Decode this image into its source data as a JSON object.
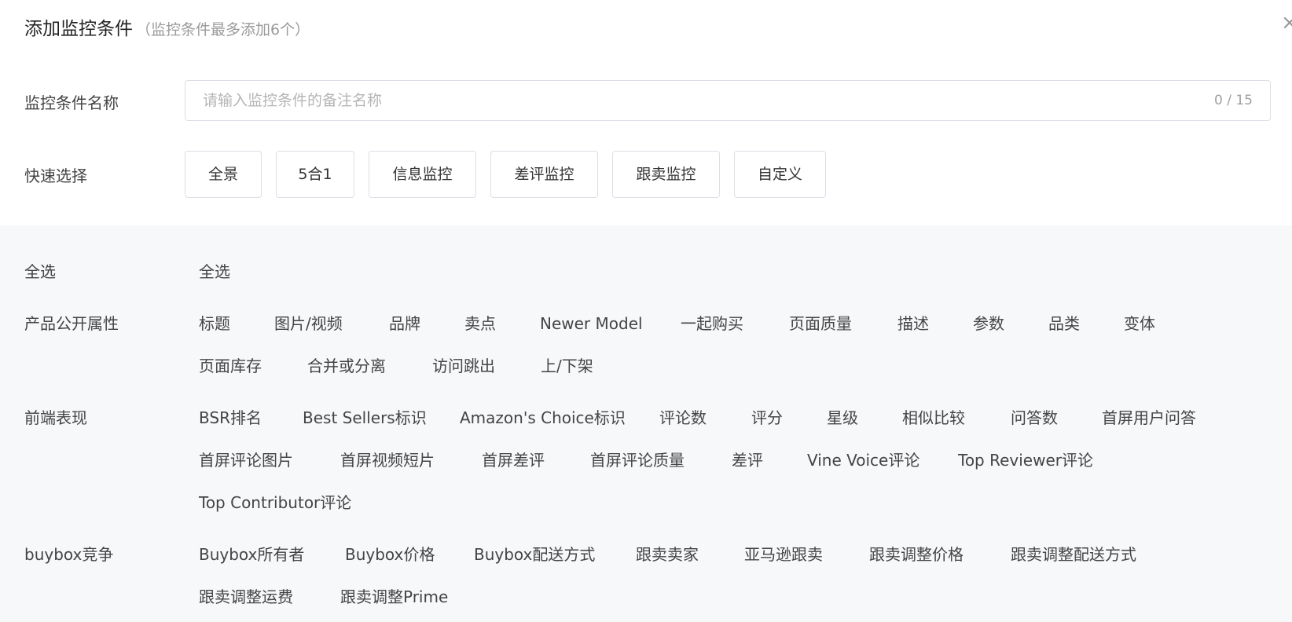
{
  "dialog": {
    "title": "添加监控条件",
    "subtitle": "（监控条件最多添加6个）",
    "close_glyph": "×"
  },
  "name_field": {
    "label": "监控条件名称",
    "placeholder": "请输入监控条件的备注名称",
    "value": "",
    "counter": "0 / 15"
  },
  "quick_select": {
    "label": "快速选择",
    "buttons": [
      "全景",
      "5合1",
      "信息监控",
      "差评监控",
      "跟卖监控",
      "自定义"
    ]
  },
  "groups": {
    "select_all": {
      "label": "全选",
      "items": [
        "全选"
      ]
    },
    "product_attrs": {
      "label": "产品公开属性",
      "items": [
        "标题",
        "图片/视频",
        "品牌",
        "卖点",
        "Newer Model",
        "一起购买",
        "页面质量",
        "描述",
        "参数",
        "品类",
        "变体",
        "页面库存",
        "合并或分离",
        "访问跳出",
        "上/下架"
      ]
    },
    "frontend": {
      "label": "前端表现",
      "items": [
        "BSR排名",
        "Best Sellers标识",
        "Amazon's Choice标识",
        "评论数",
        "评分",
        "星级",
        "相似比较",
        "问答数",
        "首屏用户问答",
        "首屏评论图片",
        "首屏视频短片",
        "首屏差评",
        "首屏评论质量",
        "差评",
        "Vine Voice评论",
        "Top Reviewer评论",
        "Top Contributor评论"
      ]
    },
    "buybox": {
      "label": "buybox竞争",
      "items": [
        "Buybox所有者",
        "Buybox价格",
        "Buybox配送方式",
        "跟卖卖家",
        "亚马逊跟卖",
        "跟卖调整价格",
        "跟卖调整配送方式",
        "跟卖调整运费",
        "跟卖调整Prime"
      ]
    }
  }
}
